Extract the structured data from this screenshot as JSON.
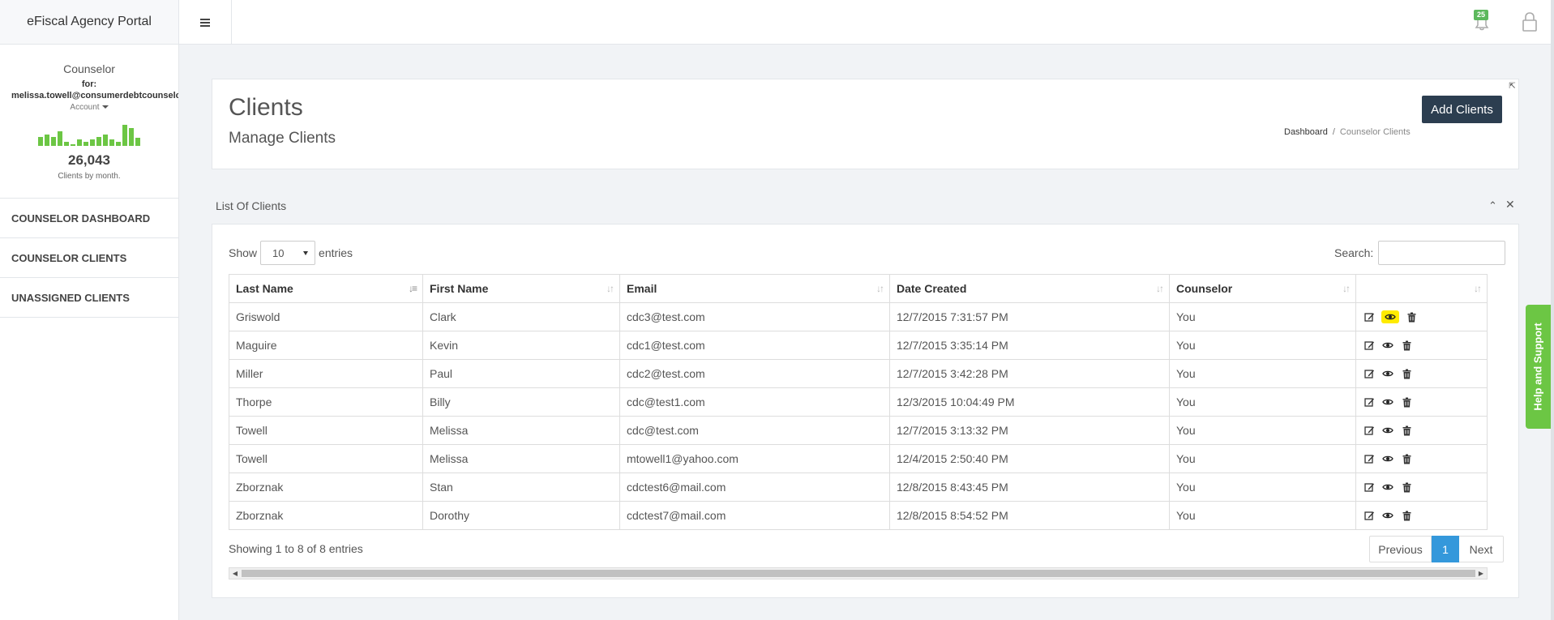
{
  "app": {
    "title": "eFiscal Agency Portal"
  },
  "header": {
    "notification_count": "25"
  },
  "sidebar": {
    "role": "Counselor",
    "for_label": "for:",
    "user_email": "melissa.towell@consumerdebtcounselors.org",
    "account_label": "Account",
    "clients_total": "26,043",
    "clients_caption": "Clients by month.",
    "sparkline": [
      0.35,
      0.45,
      0.35,
      0.55,
      0.15,
      0.05,
      0.25,
      0.15,
      0.25,
      0.35,
      0.45,
      0.25,
      0.15,
      0.8,
      0.7,
      0.3
    ],
    "nav": [
      {
        "label": "COUNSELOR DASHBOARD"
      },
      {
        "label": "COUNSELOR CLIENTS"
      },
      {
        "label": "UNASSIGNED CLIENTS"
      }
    ]
  },
  "page": {
    "title": "Clients",
    "subtitle": "Manage Clients",
    "add_button": "Add Clients",
    "breadcrumb": {
      "home": "Dashboard",
      "separator": "/",
      "current": "Counselor Clients"
    }
  },
  "list": {
    "title": "List Of Clients",
    "show_label": "Show",
    "entries_value": "10",
    "entries_label": "entries",
    "search_label": "Search:",
    "columns": [
      "Last Name",
      "First Name",
      "Email",
      "Date Created",
      "Counselor"
    ],
    "rows": [
      {
        "last": "Griswold",
        "first": "Clark",
        "email": "cdc3@test.com",
        "date": "12/7/2015 7:31:57 PM",
        "counselor": "You"
      },
      {
        "last": "Maguire",
        "first": "Kevin",
        "email": "cdc1@test.com",
        "date": "12/7/2015 3:35:14 PM",
        "counselor": "You"
      },
      {
        "last": "Miller",
        "first": "Paul",
        "email": "cdc2@test.com",
        "date": "12/7/2015 3:42:28 PM",
        "counselor": "You"
      },
      {
        "last": "Thorpe",
        "first": "Billy",
        "email": "cdc@test1.com",
        "date": "12/3/2015 10:04:49 PM",
        "counselor": "You"
      },
      {
        "last": "Towell",
        "first": "Melissa",
        "email": "cdc@test.com",
        "date": "12/7/2015 3:13:32 PM",
        "counselor": "You"
      },
      {
        "last": "Towell",
        "first": "Melissa",
        "email": "mtowell1@yahoo.com",
        "date": "12/4/2015 2:50:40 PM",
        "counselor": "You"
      },
      {
        "last": "Zborznak",
        "first": "Stan",
        "email": "cdctest6@mail.com",
        "date": "12/8/2015 8:43:45 PM",
        "counselor": "You"
      },
      {
        "last": "Zborznak",
        "first": "Dorothy",
        "email": "cdctest7@mail.com",
        "date": "12/8/2015 8:54:52 PM",
        "counselor": "You"
      }
    ],
    "footer": "Showing 1 to 8 of 8 entries",
    "pagination": {
      "previous": "Previous",
      "current": "1",
      "next": "Next"
    }
  },
  "help_tab": "Help and Support",
  "colors": {
    "accent_green": "#6cc644",
    "primary_dark": "#2c3e50",
    "active_blue": "#3498db",
    "highlight_yellow": "#ffeb00"
  }
}
